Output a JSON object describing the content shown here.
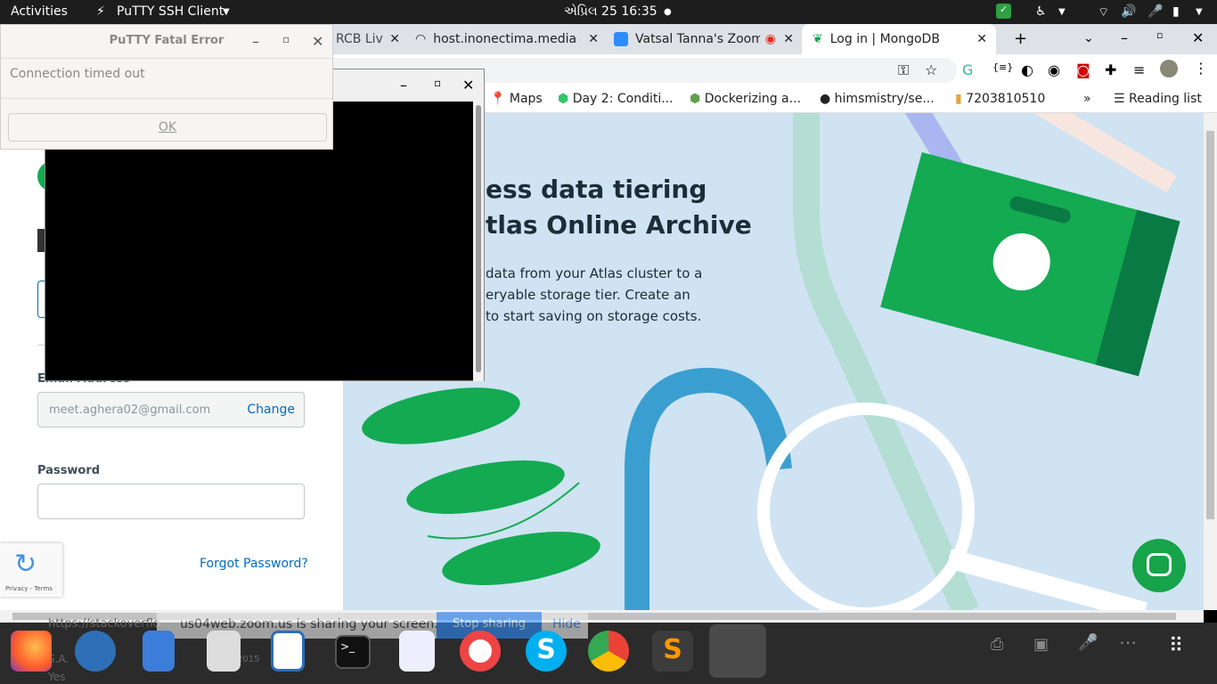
{
  "topbar": {
    "activities": "Activities",
    "app_menu": "PuTTY SSH Client",
    "clock": "એપ્રિલ 25  16:35"
  },
  "browser": {
    "tabs": [
      {
        "label": "RCB Liv"
      },
      {
        "label": "host.inonectima.media"
      },
      {
        "label": "Vatsal Tanna's Zoom"
      },
      {
        "label": "Log in | MongoDB"
      }
    ],
    "bookmarks": [
      {
        "label": "Maps"
      },
      {
        "label": "Day 2: Conditi..."
      },
      {
        "label": "Dockerizing a..."
      },
      {
        "label": "himsmistry/se..."
      },
      {
        "label": "7203810510"
      },
      {
        "label": "Reading list"
      }
    ]
  },
  "login": {
    "email_label": "Email Address",
    "email_value": "meet.aghera02@gmail.com",
    "change_label": "Change",
    "password_label": "Password",
    "password_value": "",
    "forgot_label": "Forgot Password?",
    "recaptcha_text": "Privacy - Terms"
  },
  "promo": {
    "title_line1": "ess data tiering",
    "title_line2": "tlas Online Archive",
    "body_line1": "data from your Atlas cluster to a",
    "body_line2": "eryable storage tier. Create an",
    "body_line3": "to start saving on storage costs."
  },
  "putty_error": {
    "title": "PuTTY Fatal Error",
    "message": "Connection timed out",
    "ok_label": "OK"
  },
  "zoom_bar": {
    "text": "us04web.zoom.us is sharing your screen.",
    "stop_label": "Stop sharing",
    "hide_label": "Hide"
  },
  "behind_text": {
    "url": "https://stackoverflo",
    "name": "S.A.",
    "yes": "Yes",
    "year": "6-2015"
  },
  "colors": {
    "mongo_green": "#13aa52",
    "link_blue": "#006cbc",
    "chat_green": "#16a34a"
  }
}
